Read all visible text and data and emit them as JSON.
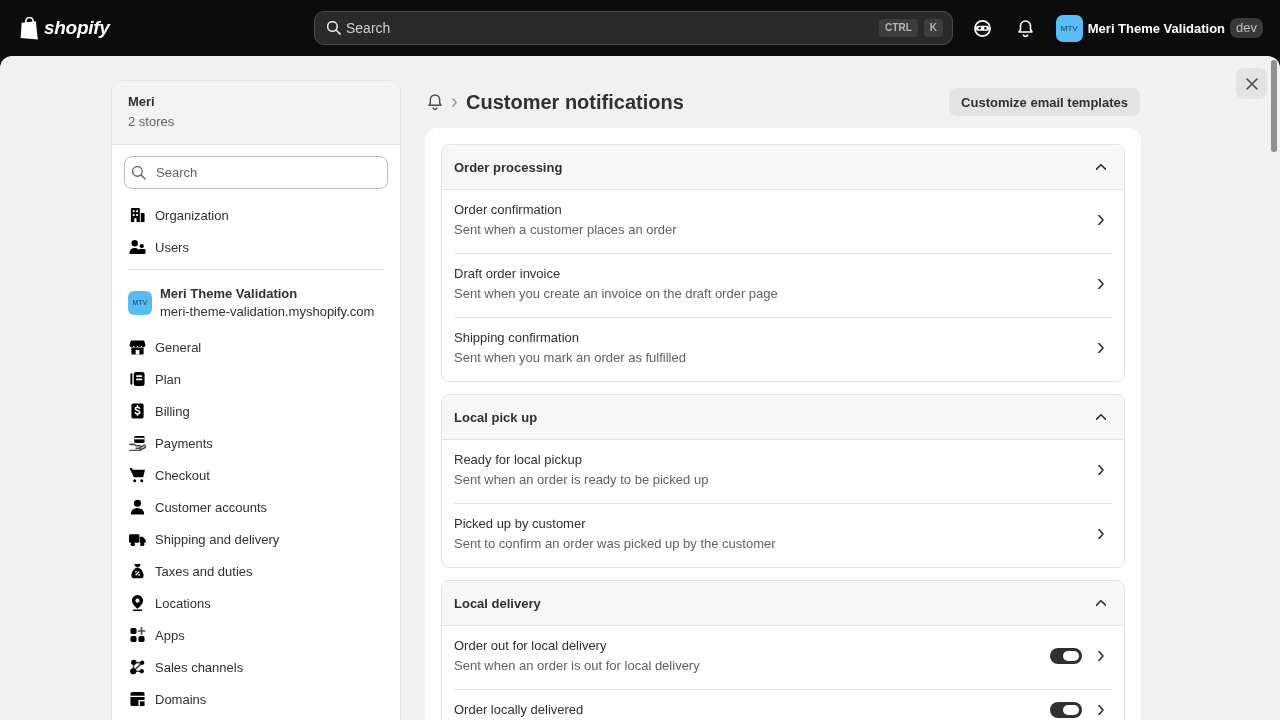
{
  "top_bar": {
    "logo_text": "shopify",
    "search": {
      "placeholder": "Search",
      "shortcut_keys": [
        "CTRL",
        "K"
      ]
    },
    "account": {
      "avatar": "MTV",
      "name": "Meri Theme Validation",
      "badge": "dev"
    }
  },
  "sidebar": {
    "org": {
      "name": "Meri",
      "subtitle": "2 stores"
    },
    "search": {
      "placeholder": "Search"
    },
    "org_items": [
      "Organization",
      "Users"
    ],
    "store": {
      "avatar": "MTV",
      "name": "Meri Theme Validation",
      "domain": "meri-theme-validation.myshopify.com"
    },
    "settings_items": [
      "General",
      "Plan",
      "Billing",
      "Payments",
      "Checkout",
      "Customer accounts",
      "Shipping and delivery",
      "Taxes and duties",
      "Locations",
      "Apps",
      "Sales channels",
      "Domains"
    ]
  },
  "page": {
    "title": "Customer notifications",
    "action": "Customize email templates"
  },
  "sections": [
    {
      "title": "Order processing",
      "expanded": true,
      "rows": [
        {
          "kind": "link",
          "title": "Order confirmation",
          "description": "Sent when a customer places an order"
        },
        {
          "kind": "link",
          "title": "Draft order invoice",
          "description": "Sent when you create an invoice on the draft order page"
        },
        {
          "kind": "link",
          "title": "Shipping confirmation",
          "description": "Sent when you mark an order as fulfilled"
        }
      ]
    },
    {
      "title": "Local pick up",
      "expanded": true,
      "rows": [
        {
          "kind": "link",
          "title": "Ready for local pickup",
          "description": "Sent when an order is ready to be picked up"
        },
        {
          "kind": "link",
          "title": "Picked up by customer",
          "description": "Sent to confirm an order was picked up by the customer"
        }
      ]
    },
    {
      "title": "Local delivery",
      "expanded": true,
      "rows": [
        {
          "kind": "toggle",
          "on": true,
          "title": "Order out for local delivery",
          "description": "Sent when an order is out for local delivery"
        },
        {
          "kind": "toggle",
          "on": true,
          "title": "Order locally delivered"
        }
      ]
    }
  ]
}
